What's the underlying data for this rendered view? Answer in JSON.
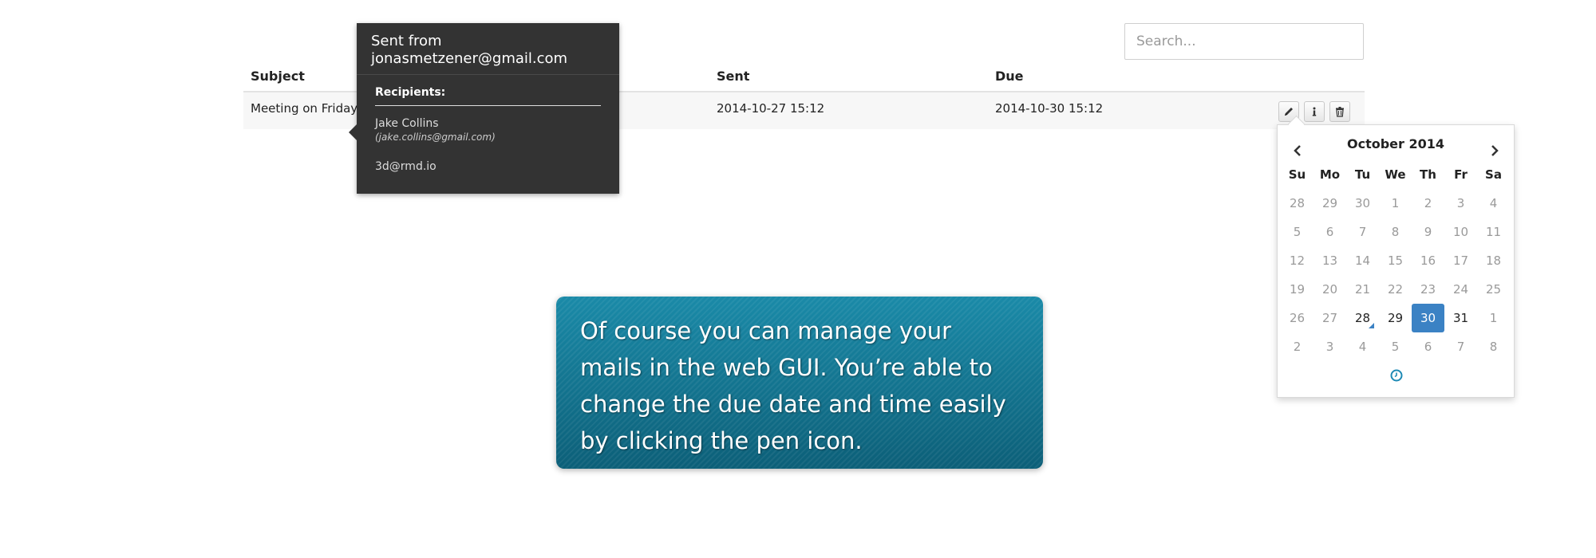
{
  "search": {
    "placeholder": "Search..."
  },
  "table": {
    "headers": {
      "subject": "Subject",
      "sent": "Sent",
      "due": "Due"
    },
    "row": {
      "subject": "Meeting on Friday",
      "sent": "2014-10-27 15:12",
      "due": "2014-10-30 15:12"
    },
    "actions": [
      {
        "icon": "pencil-icon"
      },
      {
        "icon": "info-icon"
      },
      {
        "icon": "trash-icon"
      }
    ]
  },
  "tooltip": {
    "heading": "Sent from jonasmetzener@gmail.com",
    "recipients_label": "Recipients:",
    "recipient1_name": "Jake Collins",
    "recipient1_email": "(jake.collins@gmail.com)",
    "recipient2": "3d@rmd.io"
  },
  "datepicker": {
    "month_label": "October 2014",
    "weekdays": [
      "Su",
      "Mo",
      "Tu",
      "We",
      "Th",
      "Fr",
      "Sa"
    ],
    "weeks": [
      [
        "28",
        "29",
        "30",
        "1",
        "2",
        "3",
        "4"
      ],
      [
        "5",
        "6",
        "7",
        "8",
        "9",
        "10",
        "11"
      ],
      [
        "12",
        "13",
        "14",
        "15",
        "16",
        "17",
        "18"
      ],
      [
        "19",
        "20",
        "21",
        "22",
        "23",
        "24",
        "25"
      ],
      [
        "26",
        "27",
        "28",
        "29",
        "30",
        "31",
        "1"
      ],
      [
        "2",
        "3",
        "4",
        "5",
        "6",
        "7",
        "8"
      ]
    ],
    "in_month_days": [
      "28",
      "29",
      "30",
      "31"
    ],
    "in_month_week": 4,
    "selected_day": "30",
    "today_day": "28",
    "accent_color": "#3b82c4"
  },
  "callout": {
    "text": "Of course you can manage your mails in the web GUI. You’re able to change the due date and time easily by clicking the pen icon."
  }
}
